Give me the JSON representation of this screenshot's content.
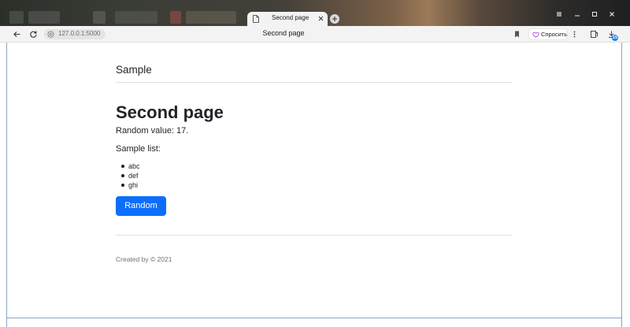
{
  "browser": {
    "tab": {
      "title": "Second page"
    },
    "address": {
      "url": "127.0.0.1:5000",
      "title": "Second page"
    },
    "ask_button_label": "Спросить",
    "downloads_badge": "15"
  },
  "page": {
    "brand": "Sample",
    "heading": "Second page",
    "random_text": "Random value: 17.",
    "list_heading": "Sample list:",
    "list_items": [
      "abc",
      "def",
      "ghi"
    ],
    "button_label": "Random",
    "footer": "Created by © 2021"
  },
  "colors": {
    "primary": "#0d6efd",
    "text": "#212529",
    "muted": "#6c757d"
  }
}
